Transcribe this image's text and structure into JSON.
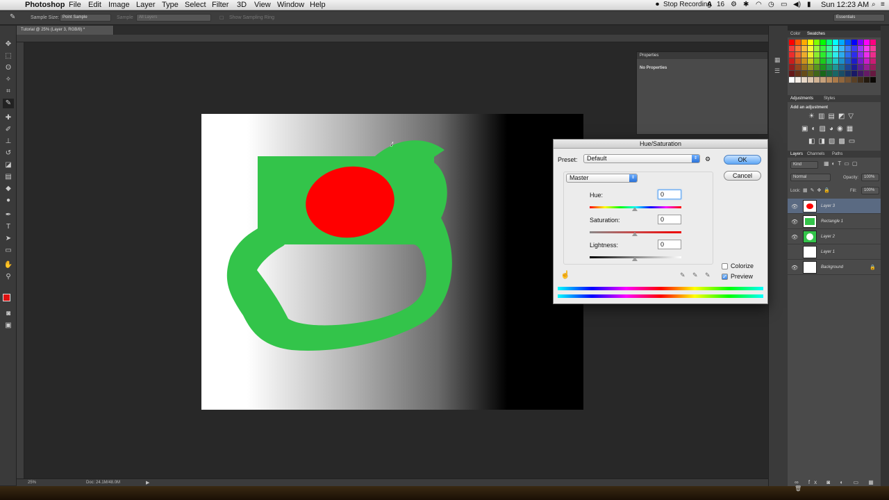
{
  "menubar": {
    "app": "Photoshop",
    "items": [
      "File",
      "Edit",
      "Image",
      "Layer",
      "Type",
      "Select",
      "Filter",
      "3D",
      "View",
      "Window",
      "Help"
    ],
    "stop_recording": "Stop Recording",
    "badge": "16",
    "clock": "Sun 12:23 AM"
  },
  "options": {
    "sample_size_label": "Sample Size:",
    "sample_size_value": "Point Sample",
    "sample_label": "Sample",
    "sample_value": "All Layers",
    "show_ring": "Show Sampling Ring",
    "workspace": "Essentials"
  },
  "document": {
    "tab": "Tutorial @ 25% (Layer 3, RGB/8) *",
    "zoom": "25%",
    "doc_size": "Doc: 24.1M/48.0M"
  },
  "properties": {
    "header": "Properties",
    "body": "No Properties"
  },
  "panels": {
    "color_tab": "Color",
    "swatches_tab": "Swatches",
    "adjustments_tab": "Adjustments",
    "styles_tab": "Styles",
    "add_adjustment": "Add an adjustment",
    "layers_tab": "Layers",
    "channels_tab": "Channels",
    "paths_tab": "Paths",
    "kind": "Kind",
    "blend_mode": "Normal",
    "opacity_label": "Opacity:",
    "opacity_value": "100%",
    "lock_label": "Lock:",
    "fill_label": "Fill:",
    "fill_value": "100%"
  },
  "layers": [
    {
      "name": "Layer 3",
      "selected": true
    },
    {
      "name": "Rectangle 1",
      "selected": false
    },
    {
      "name": "Layer 2",
      "selected": false
    },
    {
      "name": "Layer 1",
      "selected": false
    },
    {
      "name": "Background",
      "selected": false
    }
  ],
  "dialog": {
    "title": "Hue/Saturation",
    "preset_label": "Preset:",
    "preset_value": "Default",
    "channel": "Master",
    "hue_label": "Hue:",
    "hue_value": "0",
    "saturation_label": "Saturation:",
    "saturation_value": "0",
    "lightness_label": "Lightness:",
    "lightness_value": "0",
    "ok": "OK",
    "cancel": "Cancel",
    "colorize": "Colorize",
    "preview": "Preview",
    "colorize_checked": false,
    "preview_checked": true
  },
  "colors": {
    "foreground": "#e01010",
    "background": "#111111",
    "green": "#33c44a",
    "red": "#ff0000",
    "accent": "#5fa7f5"
  }
}
